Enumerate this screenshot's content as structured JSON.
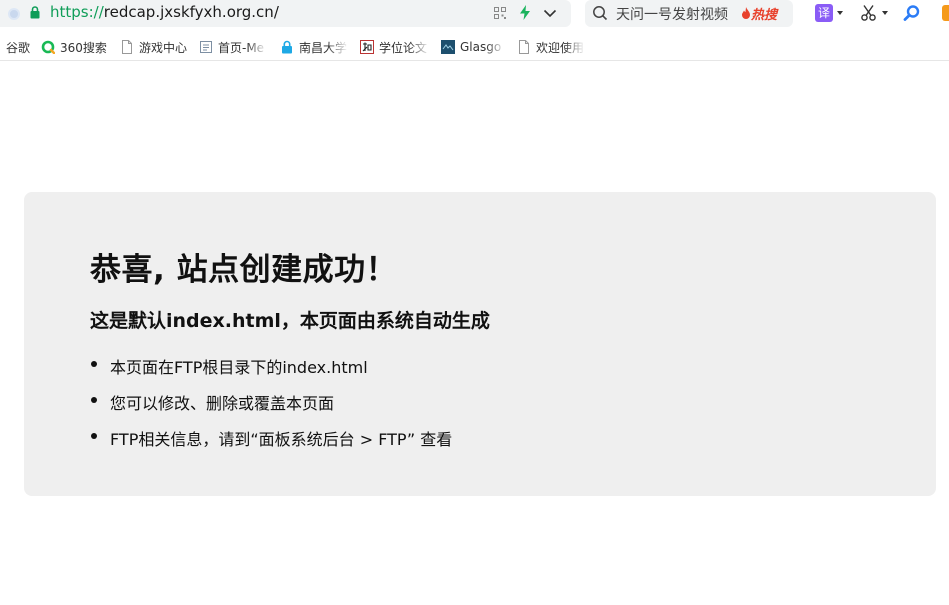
{
  "address_bar": {
    "url_scheme": "https://",
    "url_rest": "redcap.jxskfyxh.org.cn/"
  },
  "search_box": {
    "text": "天问一号发射视频",
    "hot_label": "热搜"
  },
  "toolbar": {
    "translate_label": "译"
  },
  "bookmarks": [
    {
      "label": "谷歌",
      "icon": "none"
    },
    {
      "label": "360搜索",
      "icon": "360-search-icon"
    },
    {
      "label": "游戏中心",
      "icon": "page-icon"
    },
    {
      "label": "首页-Me",
      "icon": "doc-icon"
    },
    {
      "label": "南昌大学",
      "icon": "lock-icon"
    },
    {
      "label": "学位论文",
      "icon": "zhiwang-icon"
    },
    {
      "label": "Glasgo",
      "icon": "glasgow-icon"
    },
    {
      "label": "欢迎使用",
      "icon": "page-icon"
    }
  ],
  "page": {
    "heading": "恭喜, 站点创建成功！",
    "subheading": "这是默认index.html，本页面由系统自动生成",
    "items": [
      "本页面在FTP根目录下的index.html",
      "您可以修改、删除或覆盖本页面",
      "FTP相关信息，请到“面板系统后台 > FTP” 查看"
    ]
  },
  "colors": {
    "card_background": "#efefef",
    "url_scheme": "#0f9d58",
    "hot": "#e8412c"
  }
}
